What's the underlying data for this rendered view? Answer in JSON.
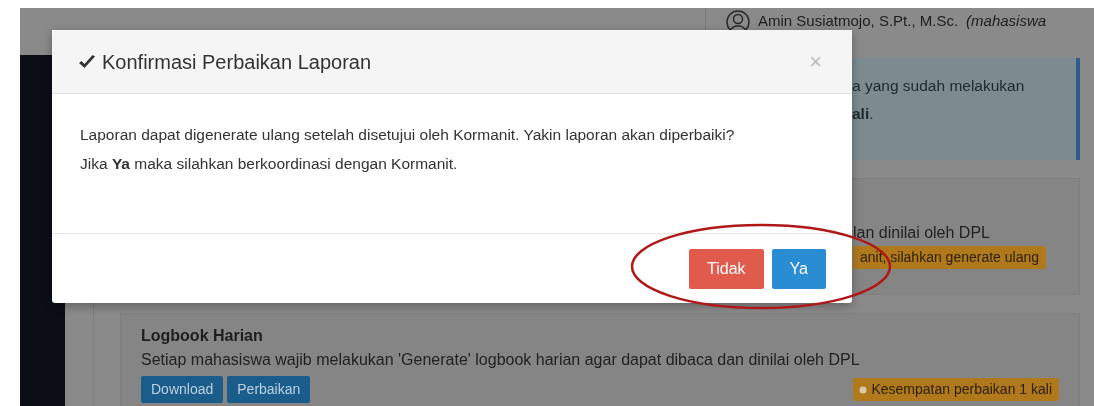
{
  "topbar": {
    "user_name": "Amin Susiatmojo, S.Pt., M.Sc.",
    "user_role": "(mahasiswa"
  },
  "alert": {
    "lines": [
      "a yang sudah melakukan",
      "**ali**."
    ]
  },
  "sections": [
    {
      "desc": "lan dinilai oleh DPL",
      "badge": "anit, silahkan generate ulang"
    },
    {
      "title": "Logbook Harian",
      "desc": "Setiap mahasiswa wajib melakukan 'Generate' logbook harian agar dapat dibaca dan dinilai oleh DPL",
      "buttons": [
        "Download",
        "Perbaikan"
      ],
      "badge": "Kesempatan perbaikan 1 kali"
    }
  ],
  "modal": {
    "title": "Konfirmasi Perbaikan Laporan",
    "close": "×",
    "body": [
      "Laporan dapat digenerate ulang setelah disetujui oleh Kormanit. Yakin laporan akan diperbaiki?",
      "Jika **Ya** maka silahkan berkoordinasi dengan Kormanit."
    ],
    "buttons": [
      {
        "label": "Tidak",
        "kind": "danger"
      },
      {
        "label": "Ya",
        "kind": "primary"
      }
    ]
  }
}
